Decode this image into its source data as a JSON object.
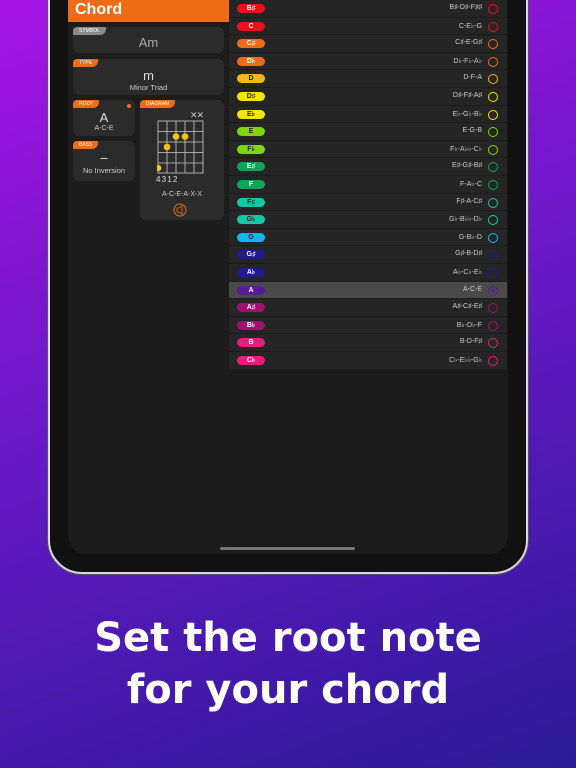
{
  "sidebar": {
    "title": "Chord",
    "symbol": {
      "label": "SYMBOL",
      "value": "Am"
    },
    "type": {
      "label": "TYPE",
      "value": "m",
      "name": "Minor Triad"
    },
    "root": {
      "label": "ROOT",
      "value": "A",
      "notes": "A-C-E"
    },
    "bass": {
      "label": "BASS",
      "value": "–",
      "name": "No Inversion"
    },
    "diagram": {
      "label": "DIAGRAM",
      "muted": "✕✕",
      "fingers": "4 3 1 2",
      "notes": "A-C-E-A-X-X",
      "icon": "sound-icon"
    }
  },
  "accent": "#ee6c17",
  "roots": [
    {
      "name": "B♯",
      "notes": "B♯-D♯-F♯♯",
      "color": "#e8131a",
      "text": "#fff"
    },
    {
      "name": "C",
      "notes": "C-E♭-G",
      "color": "#e8131a",
      "text": "#fff"
    },
    {
      "name": "C♯",
      "notes": "C♯-E-G♯",
      "color": "#ee6c17",
      "text": "#fff"
    },
    {
      "name": "D♭",
      "notes": "D♭-F♭-A♭",
      "color": "#ee6c17",
      "text": "#fff"
    },
    {
      "name": "D",
      "notes": "D-F-A",
      "color": "#f5b70b",
      "text": "#222"
    },
    {
      "name": "D♯",
      "notes": "D♯-F♯-A♯",
      "color": "#f5e40b",
      "text": "#222"
    },
    {
      "name": "E♭",
      "notes": "E♭-G♭-B♭",
      "color": "#f5e40b",
      "text": "#222"
    },
    {
      "name": "E",
      "notes": "E-G-B",
      "color": "#7ed70b",
      "text": "#222"
    },
    {
      "name": "F♭",
      "notes": "F♭-A♭♭-C♭",
      "color": "#7ed70b",
      "text": "#222"
    },
    {
      "name": "E♯",
      "notes": "E♯-G♯-B♯",
      "color": "#10a35a",
      "text": "#fff"
    },
    {
      "name": "F",
      "notes": "F-A♭-C",
      "color": "#10a35a",
      "text": "#fff"
    },
    {
      "name": "F♯",
      "notes": "F♯-A-C♯",
      "color": "#15c9a8",
      "text": "#222"
    },
    {
      "name": "G♭",
      "notes": "G♭-B♭♭-D♭",
      "color": "#15c9a8",
      "text": "#222"
    },
    {
      "name": "G",
      "notes": "G-B♭-D",
      "color": "#10b8f0",
      "text": "#222"
    },
    {
      "name": "G♯",
      "notes": "G♯-B-D♯",
      "color": "#201a8c",
      "text": "#fff"
    },
    {
      "name": "A♭",
      "notes": "A♭-C♭-E♭",
      "color": "#201a8c",
      "text": "#fff"
    },
    {
      "name": "A",
      "notes": "A-C-E",
      "color": "#5a1a9c",
      "text": "#fff",
      "selected": true
    },
    {
      "name": "A♯",
      "notes": "A♯-C♯-E♯",
      "color": "#a01070",
      "text": "#fff"
    },
    {
      "name": "B♭",
      "notes": "B♭-D♭-F",
      "color": "#a01070",
      "text": "#fff"
    },
    {
      "name": "B",
      "notes": "B-D-F♯",
      "color": "#e81c7a",
      "text": "#fff"
    },
    {
      "name": "C♭",
      "notes": "C♭-E♭♭-G♭",
      "color": "#e81c7a",
      "text": "#fff"
    }
  ],
  "caption": {
    "line1": "Set the root note",
    "line2": "for your chord"
  }
}
